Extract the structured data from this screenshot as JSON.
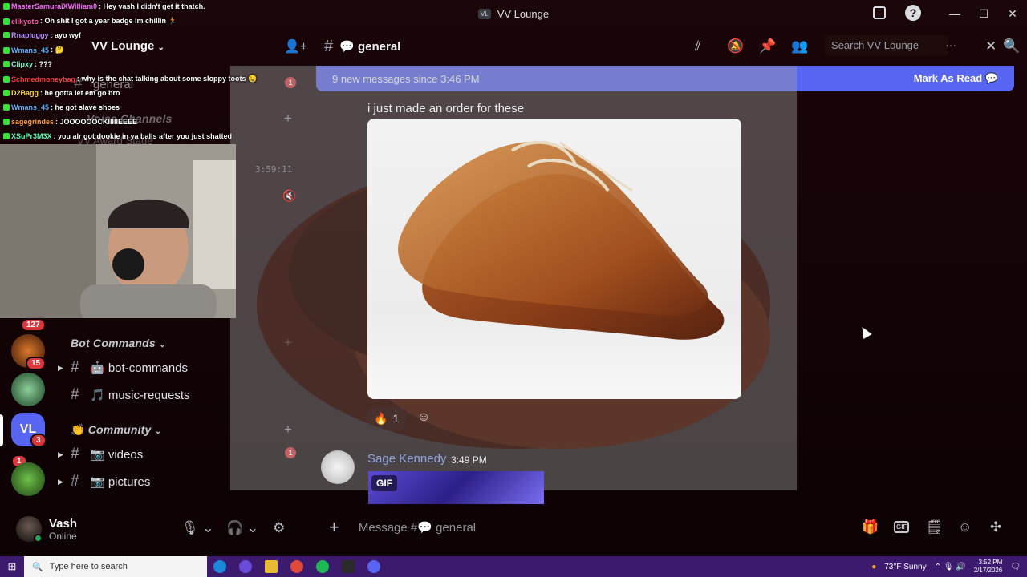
{
  "window": {
    "app_badge": "VL",
    "title": "VV Lounge",
    "minimize": "—",
    "maximize": "☐",
    "close": "✕"
  },
  "server": {
    "name": "VV Lounge",
    "faded_channel": "general",
    "faded_category": "Voice Channels",
    "faded_stage": "VV Award Stage"
  },
  "categories": {
    "bot_commands": "Bot Commands",
    "community": "Community"
  },
  "channels": {
    "bot_commands": "🤖 bot-commands",
    "music_requests": "🎵 music-requests",
    "videos": "📷 videos",
    "pictures": "📷 pictures"
  },
  "rail_badges": {
    "top": "127",
    "second": "15",
    "vl": "3",
    "frog": "1"
  },
  "rail_vl_label": "VL",
  "channel_unread": "1",
  "user": {
    "name": "Vash",
    "status": "Online"
  },
  "chat": {
    "channel_name": "💬 general",
    "search_placeholder": "Search VV Lounge",
    "new_messages": "9 new messages since 3:46 PM",
    "mark_as_read": "Mark As Read",
    "message_text": "i just made an order for these",
    "reaction_emoji": "🔥",
    "reaction_count": "1",
    "msg2_author": "Sage Kennedy",
    "msg2_time": "3:49 PM",
    "gif_label": "GIF",
    "composer_placeholder": "Message #💬 general"
  },
  "stream": {
    "timer": "3:59:11"
  },
  "stream_chat": [
    {
      "name": "MasterSamuraiXWilliam0",
      "text": ": Hey vash I didn't get it thatch.",
      "color": "#ff6cff"
    },
    {
      "name": "elikyoto",
      "text": ": Oh shit I got a year badge im chillin 🏃",
      "color": "#ff5ea8"
    },
    {
      "name": "Rnapluggy",
      "text": ": ayo wyf",
      "color": "#c58cff"
    },
    {
      "name": "Wmans_45",
      "text": ": 🤔",
      "color": "#5eb3ff"
    },
    {
      "name": "Clipxy",
      "text": ": ???",
      "color": "#7effd8"
    },
    {
      "name": "Schmedmoneybag",
      "text": ": why is the chat talking about some sloppy toots 🤤",
      "color": "#ff3b3b"
    },
    {
      "name": "D2Bagg",
      "text": ": he gotta let em go bro",
      "color": "#ffd93b"
    },
    {
      "name": "Wmans_45",
      "text": ": he got slave shoes",
      "color": "#5eb3ff"
    },
    {
      "name": "sagegrindes",
      "text": ": JOOOOOOCKIIIIIEEEE",
      "color": "#ff9a3b"
    },
    {
      "name": "XSuPr3M3X",
      "text": ": you alr got dookie in ya balls after you just shatted",
      "color": "#5effb0"
    }
  ],
  "taskbar": {
    "search_placeholder": "Type here to search",
    "weather": "73°F  Sunny",
    "time": "3:52 PM",
    "date": "2/17/2026"
  },
  "colors": {
    "accent": "#5865f2",
    "danger": "#da373c",
    "online": "#23a55a",
    "taskbar": "#3c1a6e"
  }
}
